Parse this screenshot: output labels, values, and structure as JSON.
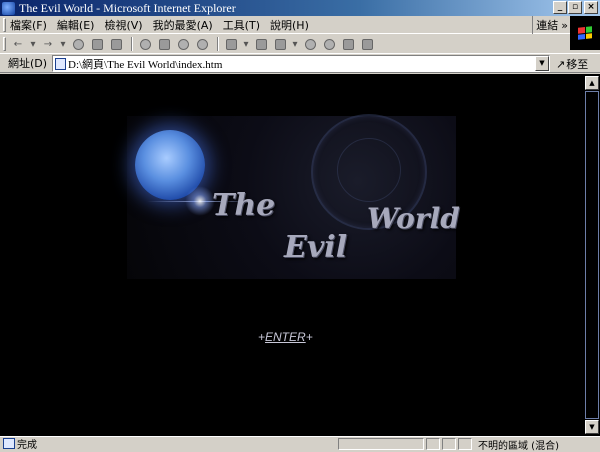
{
  "window": {
    "title": "The Evil World - Microsoft Internet Explorer",
    "controls": [
      "_",
      "▫",
      "×"
    ]
  },
  "menubar": {
    "items": [
      "檔案(F)",
      "編輯(E)",
      "檢視(V)",
      "我的最愛(A)",
      "工具(T)",
      "說明(H)"
    ],
    "links_label": "連結",
    "links_chevron": "»"
  },
  "toolbar": {
    "icons": [
      "back-icon",
      "forward-icon",
      "stop-icon",
      "refresh-icon",
      "home-icon",
      "search-icon",
      "favorites-icon",
      "history-icon",
      "media-icon",
      "mail-icon",
      "print-icon",
      "edit-icon",
      "discuss-icon",
      "messenger-icon",
      "research-icon"
    ]
  },
  "addressbar": {
    "label": "網址(D)",
    "url": "D:\\網頁\\The Evil World\\index.htm",
    "go_label": "移至"
  },
  "page": {
    "banner": {
      "word_the": "The",
      "word_evil": "Evil",
      "word_world": "World"
    },
    "enter_link": {
      "prefix": "+",
      "label": "ENTER",
      "suffix": "+"
    }
  },
  "statusbar": {
    "status": "完成",
    "zone": "不明的區域 (混合)"
  },
  "colors": {
    "titlebar_start": "#0a246a",
    "titlebar_end": "#a6caf0",
    "content_bg": "#000000",
    "chrome_bg": "#d4d0c8"
  }
}
